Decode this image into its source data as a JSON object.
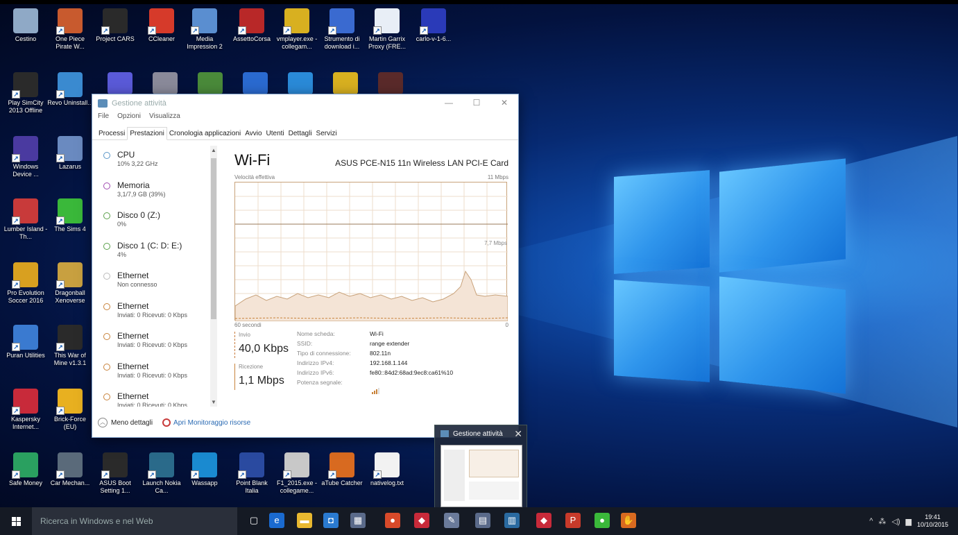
{
  "desktop_icons": [
    {
      "label": "Cestino",
      "color": "#8fa9c6"
    },
    {
      "label": "One Piece Pirate W...",
      "color": "#c85a2e"
    },
    {
      "label": "Project CARS",
      "color": "#2a2a2a"
    },
    {
      "label": "CCleaner",
      "color": "#d63a2a"
    },
    {
      "label": "Media Impression 2",
      "color": "#5a8ed0"
    },
    {
      "label": "AssettoCorsa",
      "color": "#b82828"
    },
    {
      "label": "vmplayer.exe - collegam...",
      "color": "#d8b020"
    },
    {
      "label": "Strumento di download i...",
      "color": "#3a6ad0"
    },
    {
      "label": "Martin Garrix Proxy (FRE...",
      "color": "#e8eef6"
    },
    {
      "label": "carlo-v-1-6...",
      "color": "#2a3ab8"
    },
    {
      "label": "Play SimCity 2013 Offline",
      "color": "#2a2a2a"
    },
    {
      "label": "Revo Uninstall...",
      "color": "#3a8ad0"
    },
    {
      "label": "Windows Device ...",
      "color": "#4a3aa0"
    },
    {
      "label": "Lazarus",
      "color": "#6a8ac0"
    },
    {
      "label": "Lumber Island - Th...",
      "color": "#c83a3a"
    },
    {
      "label": "The Sims 4",
      "color": "#3ab83a"
    },
    {
      "label": "Pro Evolution Soccer 2016",
      "color": "#d8a020"
    },
    {
      "label": "Dragonball Xenoverse",
      "color": "#c8a040"
    },
    {
      "label": "Puran Utilities",
      "color": "#3a7ad0"
    },
    {
      "label": "This War of Mine v1.3.1",
      "color": "#2a2a2a"
    },
    {
      "label": "Kaspersky Internet...",
      "color": "#c82a3a"
    },
    {
      "label": "Brick-Force (EU)",
      "color": "#e8b020"
    },
    {
      "label": "Safe Money",
      "color": "#2aa060"
    },
    {
      "label": "Car Mechan...",
      "color": "#5a6a7a"
    },
    {
      "label": "ASUS Boot Setting 1...",
      "color": "#2a2a2a"
    },
    {
      "label": "Launch Nokia Ca...",
      "color": "#2a6a8a"
    },
    {
      "label": "Wassapp",
      "color": "#1a8ad0"
    },
    {
      "label": "Point Blank Italia",
      "color": "#2a4aa0"
    },
    {
      "label": "F1_2015.exe - collegame...",
      "color": "#c8c8c8"
    },
    {
      "label": "aTube Catcher",
      "color": "#d86a20"
    },
    {
      "label": "nativelog.txt",
      "color": "#f2f2f2"
    }
  ],
  "task_manager": {
    "title": "Gestione attività",
    "controls": {
      "minimize": "—",
      "maximize": "☐",
      "close": "✕"
    },
    "menu": [
      "File",
      "Opzioni",
      "Visualizza"
    ],
    "tabs": [
      "Processi",
      "Prestazioni",
      "Cronologia applicazioni",
      "Avvio",
      "Utenti",
      "Dettagli",
      "Servizi"
    ],
    "active_tab": "Prestazioni",
    "resources": [
      {
        "name": "CPU",
        "sub": "10% 3,22 GHz",
        "color": "#5a96c8"
      },
      {
        "name": "Memoria",
        "sub": "3,1/7,9 GB (39%)",
        "color": "#a04ab0"
      },
      {
        "name": "Disco 0 (Z:)",
        "sub": "0%",
        "color": "#5aa04a"
      },
      {
        "name": "Disco 1 (C: D: E:)",
        "sub": "4%",
        "color": "#5aa04a"
      },
      {
        "name": "Ethernet",
        "sub": "Non connesso",
        "color": "#bbbbbb"
      },
      {
        "name": "Ethernet",
        "sub": "Inviati: 0 Ricevuti: 0 Kbps",
        "color": "#c8823a"
      },
      {
        "name": "Ethernet",
        "sub": "Inviati: 0 Ricevuti: 0 Kbps",
        "color": "#c8823a"
      },
      {
        "name": "Ethernet",
        "sub": "Inviati: 0 Ricevuti: 0 Kbps",
        "color": "#c8823a"
      },
      {
        "name": "Ethernet",
        "sub": "Inviati: 0 Ricevuti: 0 Kbps",
        "color": "#c8823a"
      }
    ],
    "main": {
      "title": "Wi-Fi",
      "device": "ASUS PCE-N15 11n Wireless LAN PCI-E Card",
      "graph_caption": "Velocità effettiva",
      "graph_max": "11 Mbps",
      "graph_mid": "7,7 Mbps",
      "graph_xlabel": "60 secondi",
      "graph_zero": "0",
      "send_label": "Invio",
      "send_value": "40,0 Kbps",
      "recv_label": "Ricezione",
      "recv_value": "1,1 Mbps",
      "details": [
        {
          "k": "Nome scheda:",
          "v": "Wi-Fi"
        },
        {
          "k": "SSID:",
          "v": "range extender"
        },
        {
          "k": "Tipo di connessione:",
          "v": "802.11n"
        },
        {
          "k": "Indirizzo IPv4:",
          "v": "192.168.1.144"
        },
        {
          "k": "Indirizzo IPv6:",
          "v": "fe80::84d2:68ad:9ec8:ca61%10"
        },
        {
          "k": "Potenza segnale:",
          "v": ""
        }
      ]
    },
    "footer": {
      "less": "Meno dettagli",
      "monitor": "Apri Monitoraggio risorse"
    }
  },
  "preview": {
    "title": "Gestione attività"
  },
  "taskbar": {
    "search_placeholder": "Ricerca in Windows e nel Web",
    "apps": [
      {
        "name": "task-view",
        "glyph": "▢",
        "color": "#151a24"
      },
      {
        "name": "edge",
        "glyph": "e",
        "color": "#1a6ad0"
      },
      {
        "name": "file-explorer",
        "glyph": "▬",
        "color": "#e8b830"
      },
      {
        "name": "store",
        "glyph": "◘",
        "color": "#2a7ad0"
      },
      {
        "name": "app-5",
        "glyph": "▦",
        "color": "#5a6a8a"
      },
      {
        "name": "chrome",
        "glyph": "●",
        "color": "#d84a2a"
      },
      {
        "name": "app-7",
        "glyph": "◆",
        "color": "#c82a3a"
      },
      {
        "name": "app-8",
        "glyph": "✎",
        "color": "#6a7a9a"
      },
      {
        "name": "app-9",
        "glyph": "▤",
        "color": "#5a6a8a"
      },
      {
        "name": "app-10",
        "glyph": "▥",
        "color": "#2a6aa0"
      },
      {
        "name": "app-11",
        "glyph": "◆",
        "color": "#c82a3a"
      },
      {
        "name": "powerpoint",
        "glyph": "P",
        "color": "#c83a2a"
      },
      {
        "name": "app-13",
        "glyph": "●",
        "color": "#3ab83a"
      },
      {
        "name": "atube",
        "glyph": "✋",
        "color": "#d86a20"
      }
    ],
    "tray_symbols": [
      "^",
      "⁂",
      "◁)",
      "▆"
    ],
    "time": "19:41",
    "date": "10/10/2015"
  }
}
